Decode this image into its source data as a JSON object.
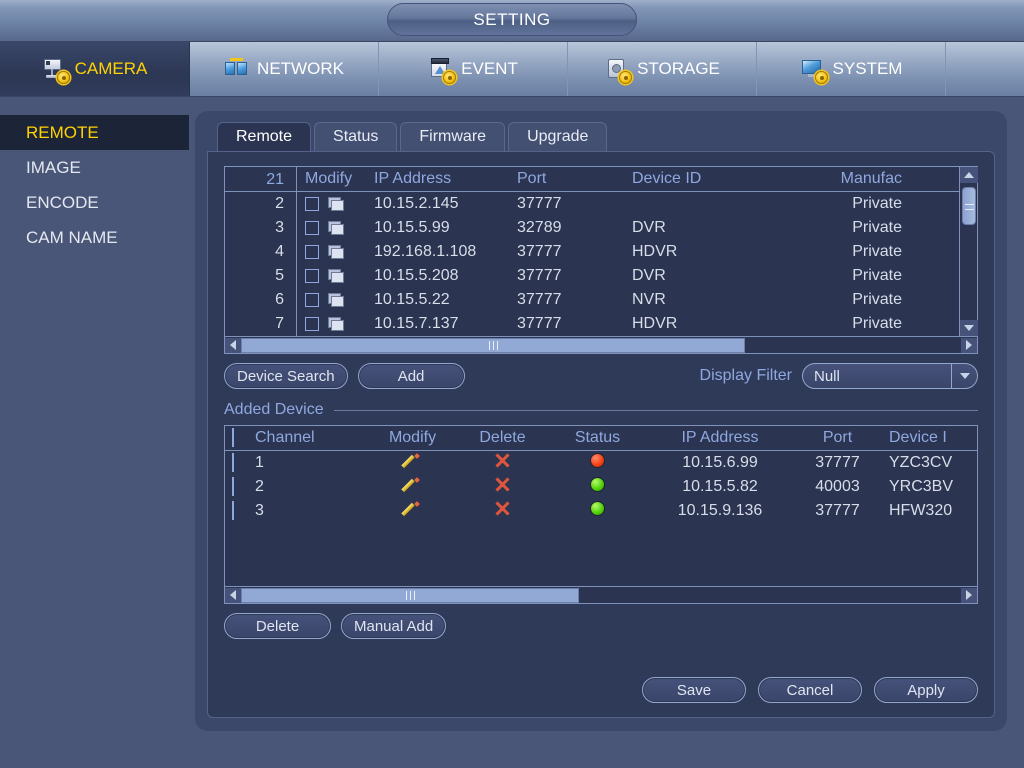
{
  "window": {
    "title": "SETTING"
  },
  "topnav": [
    {
      "label": "CAMERA",
      "icon": "camera-icon",
      "active": true
    },
    {
      "label": "NETWORK",
      "icon": "network-icon",
      "active": false
    },
    {
      "label": "EVENT",
      "icon": "event-icon",
      "active": false
    },
    {
      "label": "STORAGE",
      "icon": "storage-icon",
      "active": false
    },
    {
      "label": "SYSTEM",
      "icon": "system-icon",
      "active": false
    }
  ],
  "sidebar": {
    "items": [
      {
        "label": "REMOTE",
        "active": true
      },
      {
        "label": "IMAGE",
        "active": false
      },
      {
        "label": "ENCODE",
        "active": false
      },
      {
        "label": "CAM NAME",
        "active": false
      }
    ]
  },
  "tabs": [
    {
      "label": "Remote",
      "active": true
    },
    {
      "label": "Status",
      "active": false
    },
    {
      "label": "Firmware",
      "active": false
    },
    {
      "label": "Upgrade",
      "active": false
    }
  ],
  "search_table": {
    "headers": {
      "count": "21",
      "modify": "Modify",
      "ip": "IP Address",
      "port": "Port",
      "device_id": "Device ID",
      "manufacturer": "Manufac"
    },
    "rows": [
      {
        "index": "2",
        "ip": "10.15.2.145",
        "port": "37777",
        "device_id": "",
        "manufacturer": "Private"
      },
      {
        "index": "3",
        "ip": "10.15.5.99",
        "port": "32789",
        "device_id": "DVR",
        "manufacturer": "Private"
      },
      {
        "index": "4",
        "ip": "192.168.1.108",
        "port": "37777",
        "device_id": "HDVR",
        "manufacturer": "Private"
      },
      {
        "index": "5",
        "ip": "10.15.5.208",
        "port": "37777",
        "device_id": "DVR",
        "manufacturer": "Private"
      },
      {
        "index": "6",
        "ip": "10.15.5.22",
        "port": "37777",
        "device_id": "NVR",
        "manufacturer": "Private"
      },
      {
        "index": "7",
        "ip": "10.15.7.137",
        "port": "37777",
        "device_id": "HDVR",
        "manufacturer": "Private"
      }
    ]
  },
  "toolbar": {
    "device_search": "Device Search",
    "add": "Add",
    "display_filter_label": "Display Filter",
    "display_filter_value": "Null"
  },
  "added_section": {
    "title": "Added Device",
    "headers": {
      "channel": "Channel",
      "modify": "Modify",
      "delete": "Delete",
      "status": "Status",
      "ip": "IP Address",
      "port": "Port",
      "device_id": "Device I"
    },
    "rows": [
      {
        "channel": "1",
        "status": "red",
        "ip": "10.15.6.99",
        "port": "37777",
        "device_id": "YZC3CV"
      },
      {
        "channel": "2",
        "status": "green",
        "ip": "10.15.5.82",
        "port": "40003",
        "device_id": "YRC3BV"
      },
      {
        "channel": "3",
        "status": "green",
        "ip": "10.15.9.136",
        "port": "37777",
        "device_id": "HFW320"
      }
    ]
  },
  "footer": {
    "delete": "Delete",
    "manual_add": "Manual Add",
    "save": "Save",
    "cancel": "Cancel",
    "apply": "Apply"
  },
  "colors": {
    "accent_yellow": "#ffd200",
    "header_blue": "#8fa8e0",
    "status_red": "#f43e12",
    "status_green": "#56d30c"
  }
}
